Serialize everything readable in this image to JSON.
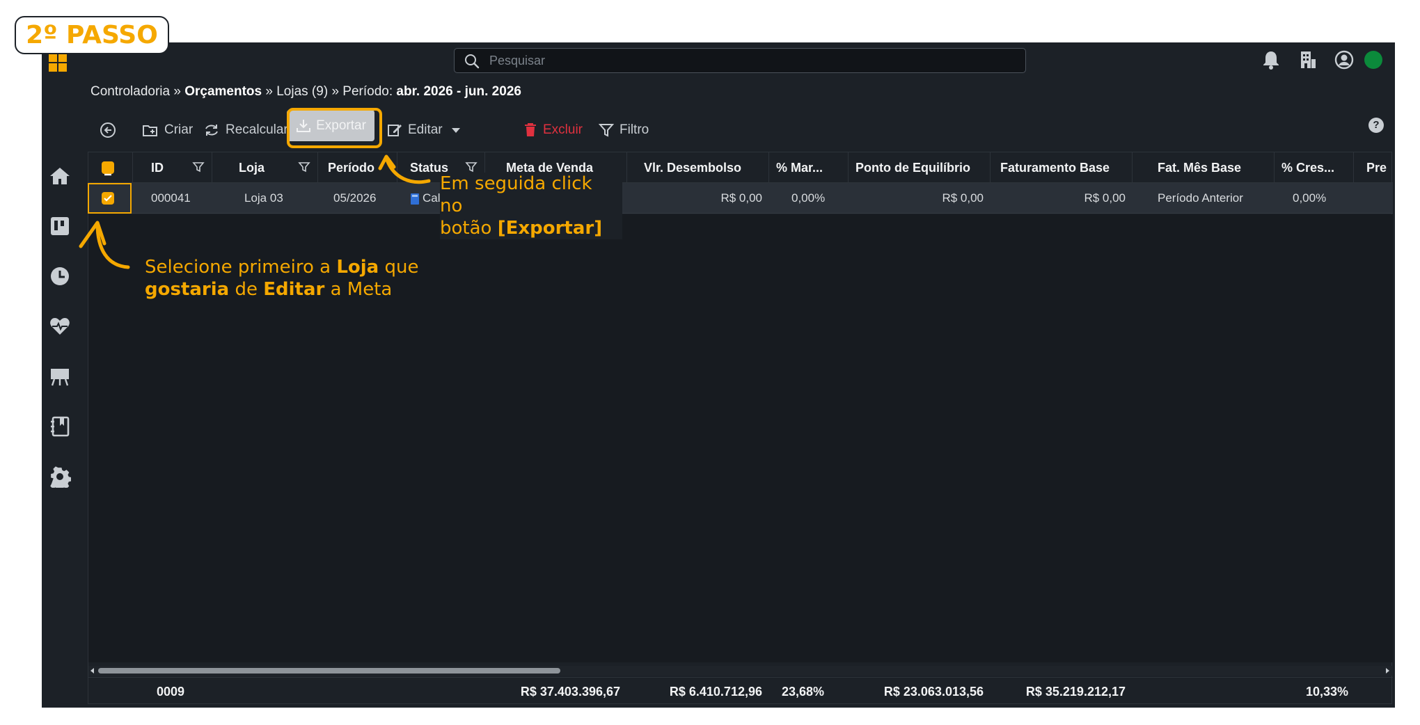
{
  "step": {
    "label": "2º PASSO"
  },
  "search": {
    "placeholder": "Pesquisar"
  },
  "breadcrumb": {
    "part1": "Controladoria",
    "sep": "»",
    "part2": "Orçamentos",
    "part3": "Lojas (9)",
    "part4_label": "Período:",
    "part4_value": "abr. 2026 - jun. 2026"
  },
  "toolbar": {
    "criar": "Criar",
    "recalcular": "Recalcular",
    "exportar": "Exportar",
    "editar": "Editar",
    "excluir": "Excluir",
    "filtro": "Filtro",
    "help": "?"
  },
  "grid": {
    "columns": [
      "ID",
      "Loja",
      "Período",
      "Status",
      "Meta de Venda",
      "Vlr. Desembolso",
      "% Mar...",
      "Ponto de Equilíbrio",
      "Faturamento Base",
      "Fat. Mês Base",
      "% Cres...",
      "Pre"
    ],
    "row": {
      "id": "000041",
      "loja": "Loja 03",
      "periodo": "05/2026",
      "status": "Calc",
      "vlr_desembolso": "R$ 0,00",
      "margem": "0,00%",
      "ponto_equilibrio": "R$ 0,00",
      "faturamento_base": "R$ 0,00",
      "fat_mes_base": "Período Anterior",
      "crescimento": "0,00%"
    },
    "footer": {
      "count": "0009",
      "meta_venda": "R$ 37.403.396,67",
      "vlr_desembolso": "R$ 6.410.712,96",
      "margem": "23,68%",
      "ponto_equilibrio": "R$ 23.063.013,56",
      "faturamento_base": "R$ 35.219.212,17",
      "crescimento": "10,33%"
    }
  },
  "annotations": {
    "export_line1": "Em seguida click no",
    "export_line2_a": "botão ",
    "export_line2_b": "[Exportar]",
    "select_a": "Selecione primeiro a ",
    "select_b": "Loja",
    "select_c": " que",
    "select_d": "gostaria",
    "select_e": " de ",
    "select_f": "Editar",
    "select_g": " a Meta"
  },
  "colors": {
    "accent": "#f5a800",
    "app_bg": "#1c2127",
    "danger": "#e0313f",
    "online": "#0b8a3b",
    "status_icon": "#2f6fd6"
  },
  "icons": {
    "topbar": [
      "bell-icon",
      "building-icon",
      "user-circle-icon"
    ],
    "sidebar": [
      "home-icon",
      "board-icon",
      "clock-icon",
      "heartbeat-icon",
      "presentation-icon",
      "notebook-icon",
      "gear-icon"
    ]
  }
}
